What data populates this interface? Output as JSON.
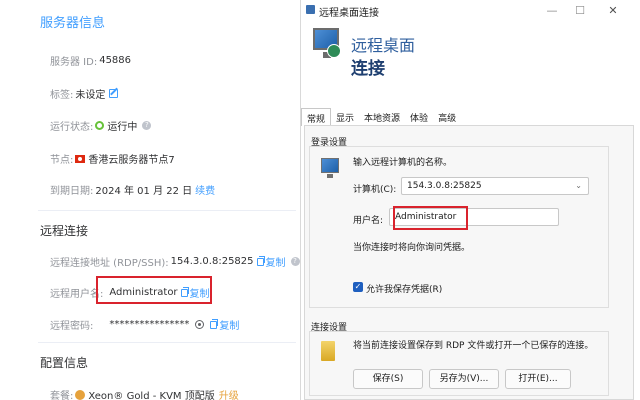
{
  "server_panel": {
    "section_server_info": "服务器信息",
    "server_id": {
      "label": "服务器 ID:",
      "value": "45886"
    },
    "tag": {
      "label": "标签:",
      "value": "未设定"
    },
    "status": {
      "label": "运行状态:",
      "value": "运行中",
      "help": "?"
    },
    "node": {
      "label": "节点:",
      "value": "香港云服务器节点7"
    },
    "expiry": {
      "label": "到期日期:",
      "value": "2024 年 01 月 22 日",
      "renew": "续费"
    },
    "section_remote": "远程连接",
    "remote_address": {
      "label": "远程连接地址 (RDP/SSH):",
      "value": "154.3.0.8:25825",
      "copy": "复制",
      "help": "?"
    },
    "remote_user": {
      "label": "远程用户名:",
      "value": "Administrator",
      "copy": "复制"
    },
    "remote_password": {
      "label": "远程密码:",
      "value": "****************",
      "copy": "复制"
    },
    "section_config": "配置信息",
    "cpu": {
      "label": "套餐:",
      "value": "Xeon® Gold - KVM 顶配版",
      "upgrade": "升级"
    }
  },
  "rdp_window": {
    "title": "远程桌面连接",
    "window_controls": {
      "minimize": "—",
      "maximize": "☐",
      "close": "✕"
    },
    "hero_line1": "远程桌面",
    "hero_line2": "连接",
    "tabs": [
      "常规",
      "显示",
      "本地资源",
      "体验",
      "高级"
    ],
    "login_settings": {
      "group_label": "登录设置",
      "prompt": "输入远程计算机的名称。",
      "computer_label": "计算机(C):",
      "computer_value": "154.3.0.8:25825",
      "username_label": "用户名:",
      "username_value": "Administrator",
      "credential_hint": "当你连接时将向你询问凭据。",
      "save_credentials_label": "允许我保存凭据(R)",
      "save_credentials_checked": true
    },
    "connection_settings": {
      "group_label": "连接设置",
      "description": "将当前连接设置保存到 RDP 文件或打开一个已保存的连接。",
      "save_button": "保存(S)",
      "save_as_button": "另存为(V)...",
      "open_button": "打开(E)..."
    }
  },
  "colors": {
    "accent": "#409eff",
    "highlight": "#d9232d",
    "running": "#67c23a",
    "upgrade": "#e6a23c"
  },
  "icons": [
    "edit-icon",
    "help-icon",
    "status-running-icon",
    "hk-flag-icon",
    "copy-icon",
    "eye-icon",
    "cpu-icon",
    "rdp-app-icon",
    "computer-icon",
    "folder-icon"
  ]
}
